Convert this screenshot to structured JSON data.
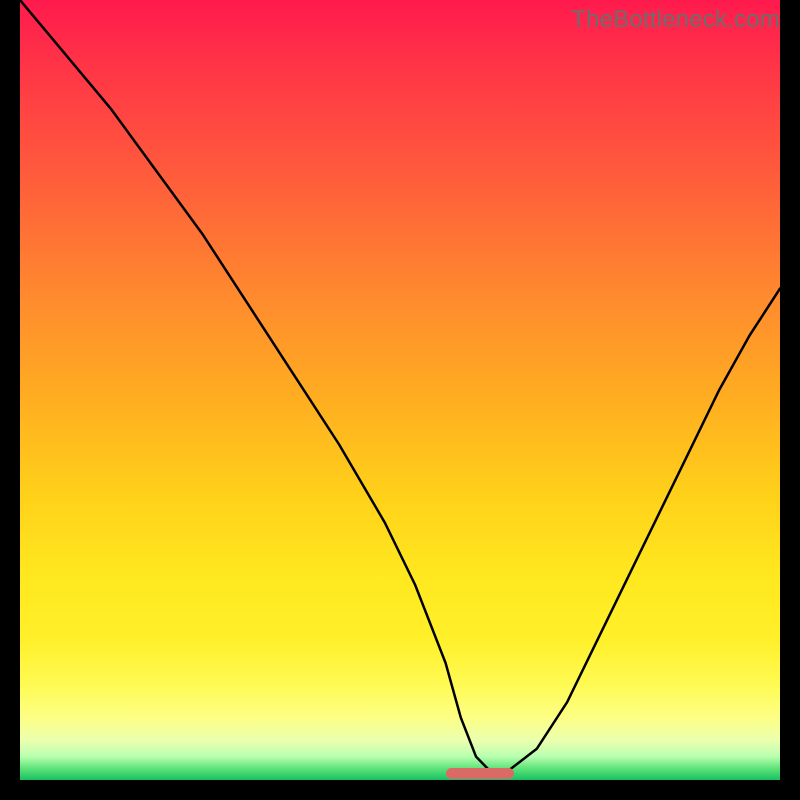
{
  "watermark": {
    "text": "TheBottleneck.com"
  },
  "colors": {
    "page_bg": "#000000",
    "curve": "#000000",
    "marker": "#d96a66",
    "watermark_text": "#6d6d6d",
    "gradient_top": "#ff1a4d",
    "gradient_mid": "#ffe81f",
    "gradient_bottom": "#18c060"
  },
  "chart_data": {
    "type": "line",
    "title": "",
    "xlabel": "",
    "ylabel": "",
    "xlim": [
      0,
      100
    ],
    "ylim": [
      0,
      100
    ],
    "grid": false,
    "legend": false,
    "series": [
      {
        "name": "bottleneck-curve",
        "x": [
          0,
          6,
          12,
          18,
          24,
          30,
          36,
          42,
          48,
          52,
          56,
          58,
          60,
          62,
          64,
          68,
          72,
          76,
          80,
          84,
          88,
          92,
          96,
          100
        ],
        "values": [
          100,
          93,
          86,
          78,
          70,
          61,
          52,
          43,
          33,
          25,
          15,
          8,
          3,
          1,
          1,
          4,
          10,
          18,
          26,
          34,
          42,
          50,
          57,
          63
        ]
      }
    ],
    "annotations": [
      {
        "name": "optimal-range-marker",
        "x_start": 56,
        "x_end": 65,
        "y": 0
      }
    ]
  }
}
